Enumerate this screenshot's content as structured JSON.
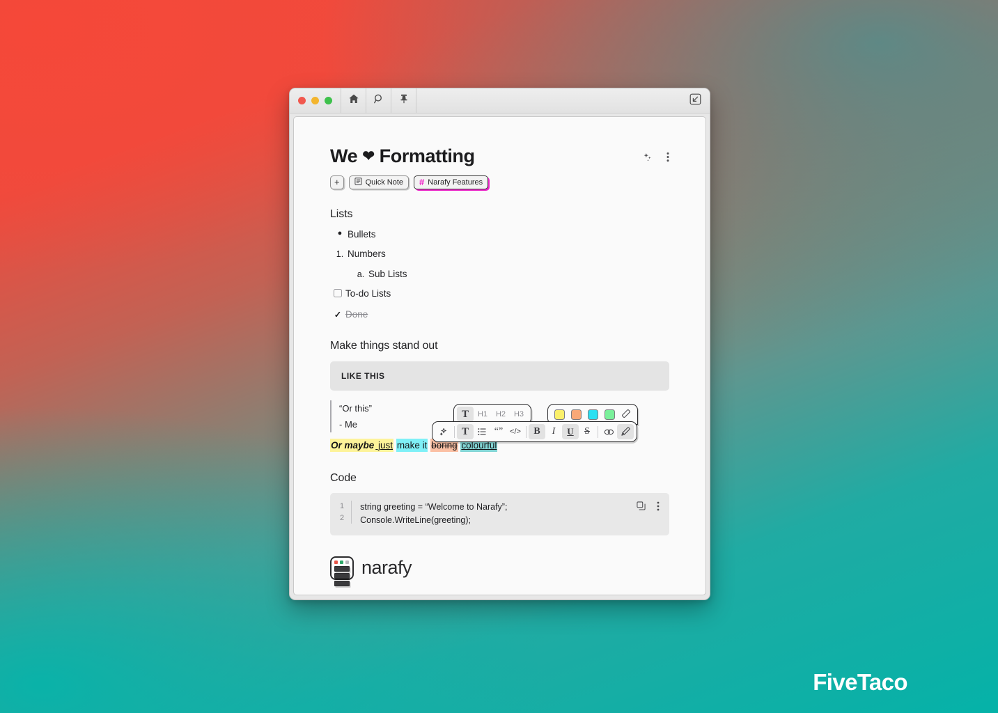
{
  "window": {
    "traffic_lights": [
      "close",
      "minimize",
      "maximize"
    ],
    "toolbar_buttons": [
      {
        "name": "home-button",
        "icon": "home-icon"
      },
      {
        "name": "search-button",
        "icon": "search-icon"
      },
      {
        "name": "pin-button",
        "icon": "pin-icon"
      }
    ],
    "collapse_button": {
      "name": "collapse-button",
      "icon": "arrow-down-left-icon"
    }
  },
  "note": {
    "title_prefix": "We ",
    "title_heart": "❤",
    "title_suffix": " Formatting",
    "actions": [
      {
        "name": "ai-sparkle-button",
        "icon": "sparkles-icon"
      },
      {
        "name": "note-more-button",
        "icon": "kebab-menu-icon"
      }
    ],
    "tags": [
      {
        "label": "+",
        "type": "add"
      },
      {
        "label": "Quick Note",
        "icon": "note-icon",
        "type": "plain"
      },
      {
        "label": "Narafy Features",
        "icon": "hash-icon",
        "type": "accent"
      }
    ]
  },
  "sections": {
    "lists_heading": "Lists",
    "standout_heading": "Make things stand out",
    "code_heading": "Code"
  },
  "lists": [
    {
      "marker": "●",
      "marker_type": "bullet",
      "text": "Bullets",
      "level": 0
    },
    {
      "marker": "1.",
      "marker_type": "number",
      "text": "Numbers",
      "level": 0
    },
    {
      "marker": "a.",
      "marker_type": "letter",
      "text": "Sub Lists",
      "level": 1
    },
    {
      "marker": "",
      "marker_type": "checkbox",
      "text": "To-do Lists",
      "level": 0
    },
    {
      "marker": "✓",
      "marker_type": "checked",
      "text": "Done",
      "level": 0
    }
  ],
  "callout": {
    "text": "LIKE THIS"
  },
  "quote": {
    "line1": "“Or this”",
    "line2": "- Me"
  },
  "colourful_line": [
    {
      "text": "Or maybe",
      "highlight": "yellow",
      "italic": true,
      "underline": false,
      "strike": false
    },
    {
      "text": " just",
      "highlight": "yellow",
      "italic": false,
      "underline": true,
      "strike": false
    },
    {
      "text": "make it",
      "highlight": "cyan",
      "italic": false,
      "underline": false,
      "strike": false
    },
    {
      "text": "boring",
      "highlight": "orange",
      "italic": false,
      "underline": false,
      "strike": true
    },
    {
      "text": "colourful",
      "highlight": "green",
      "italic": false,
      "underline": true,
      "strike": false,
      "selected": true
    }
  ],
  "code": {
    "line_numbers": [
      "1",
      "2"
    ],
    "lines": [
      "string greeting = “Welcome to Narafy”;",
      "Console.WriteLine(greeting);"
    ],
    "actions": [
      {
        "name": "copy-code-button",
        "icon": "copy-icon"
      },
      {
        "name": "code-more-button",
        "icon": "kebab-menu-icon"
      }
    ]
  },
  "logo": {
    "text": "narafy",
    "mark_squares": [
      "#e8564a",
      "#2fa86a",
      "#b9b9be"
    ]
  },
  "format_toolbar": {
    "heading_row": [
      {
        "label": "T",
        "name": "paragraph-style-button",
        "active": true
      },
      {
        "label": "H1",
        "name": "heading-1-button",
        "active": false
      },
      {
        "label": "H2",
        "name": "heading-2-button",
        "active": false
      },
      {
        "label": "H3",
        "name": "heading-3-button",
        "active": false
      }
    ],
    "swatch_row": [
      {
        "color": "#fbf06a",
        "name": "highlight-yellow-button"
      },
      {
        "color": "#f8a878",
        "name": "highlight-orange-button"
      },
      {
        "color": "#2ae0f2",
        "name": "highlight-cyan-button"
      },
      {
        "color": "#7af09a",
        "name": "highlight-green-button"
      },
      {
        "label": "◇",
        "name": "highlight-clear-button"
      }
    ],
    "main_row": [
      {
        "label": "✦",
        "name": "ai-assist-button",
        "active": false
      },
      {
        "label": "T",
        "name": "text-style-button",
        "active": true
      },
      {
        "label": "☰",
        "name": "list-button",
        "active": false
      },
      {
        "label": "“”",
        "name": "quote-button",
        "active": false
      },
      {
        "label": "</>",
        "name": "code-button",
        "active": false
      },
      {
        "label": "B",
        "name": "bold-button",
        "active": true
      },
      {
        "label": "I",
        "name": "italic-button",
        "active": false
      },
      {
        "label": "U",
        "name": "underline-button",
        "active": true
      },
      {
        "label": "S",
        "name": "strikethrough-button",
        "active": false
      },
      {
        "label": "∞",
        "name": "link-button",
        "active": false
      },
      {
        "label": "✐",
        "name": "highlighter-button",
        "active": true
      }
    ]
  },
  "watermark": {
    "text": "FiveTaco"
  },
  "colors": {
    "accent_pink": "#f020c8",
    "backdrop_red": "#f04a3c",
    "backdrop_teal": "#05b2a8",
    "highlight_yellow": "#fdf39a",
    "highlight_cyan": "#7ff0f7",
    "highlight_orange": "#fbc0a4",
    "highlight_green": "#8ef0a6"
  }
}
